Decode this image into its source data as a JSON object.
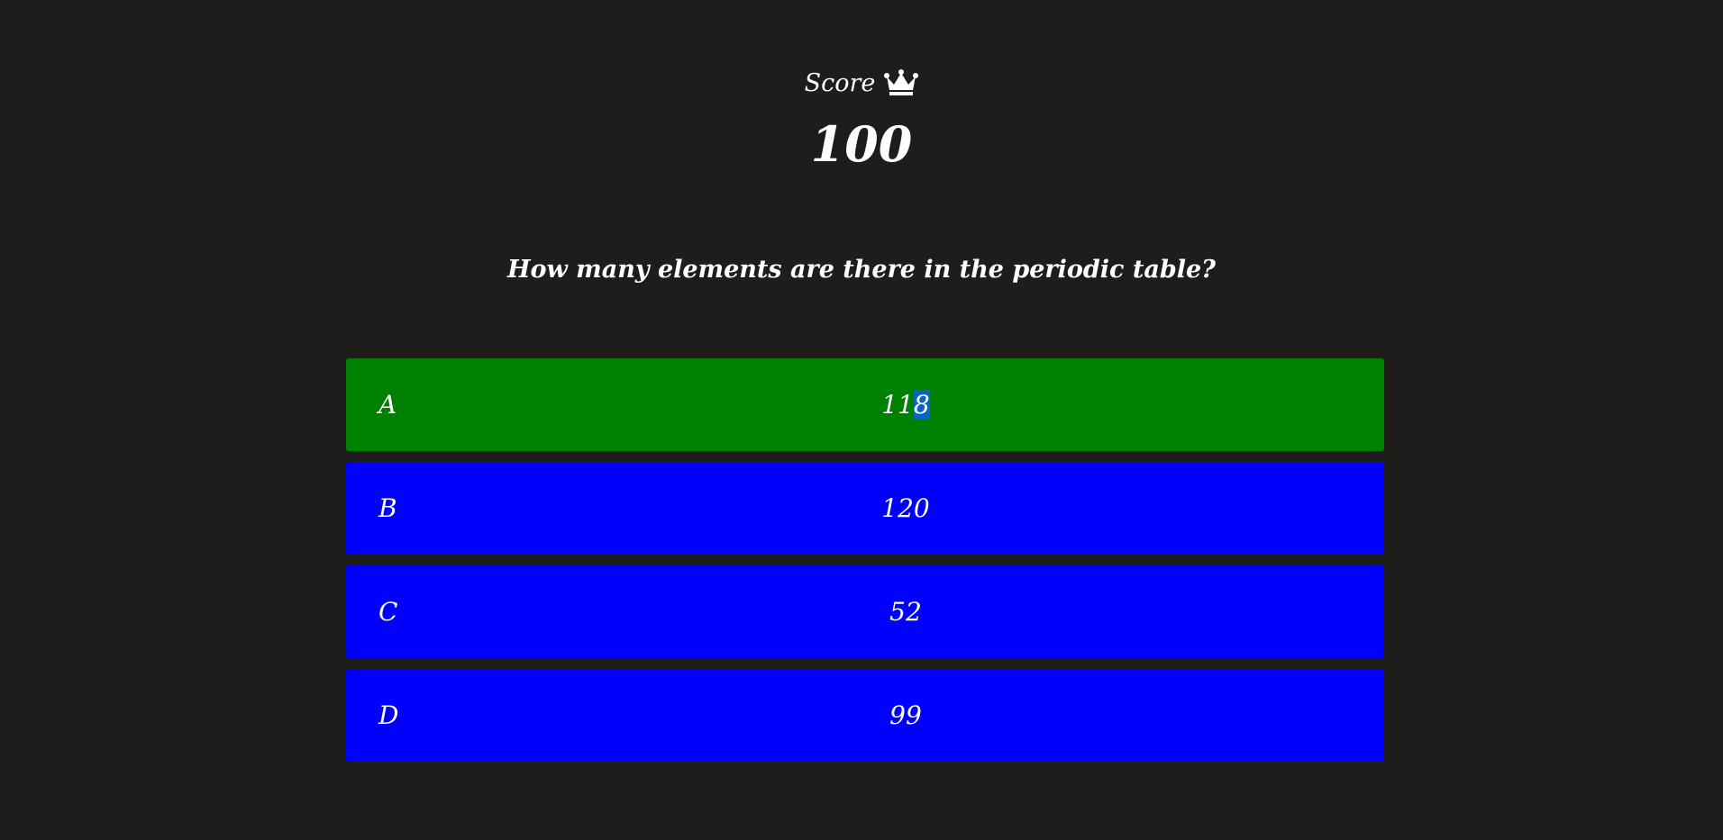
{
  "score": {
    "label": "Score",
    "icon": "crown-icon",
    "value": "100"
  },
  "question": {
    "text": "How many elements are there in the periodic table?"
  },
  "answers": [
    {
      "letter": "A",
      "text": "118",
      "state": "correct"
    },
    {
      "letter": "B",
      "text": "120",
      "state": "default"
    },
    {
      "letter": "C",
      "text": "52",
      "state": "default"
    },
    {
      "letter": "D",
      "text": "99",
      "state": "default"
    }
  ],
  "colors": {
    "background": "#1e1d1c",
    "correct": "#008000",
    "default": "#0000ff",
    "text": "#ffffff",
    "selection": "#0a64c8"
  }
}
